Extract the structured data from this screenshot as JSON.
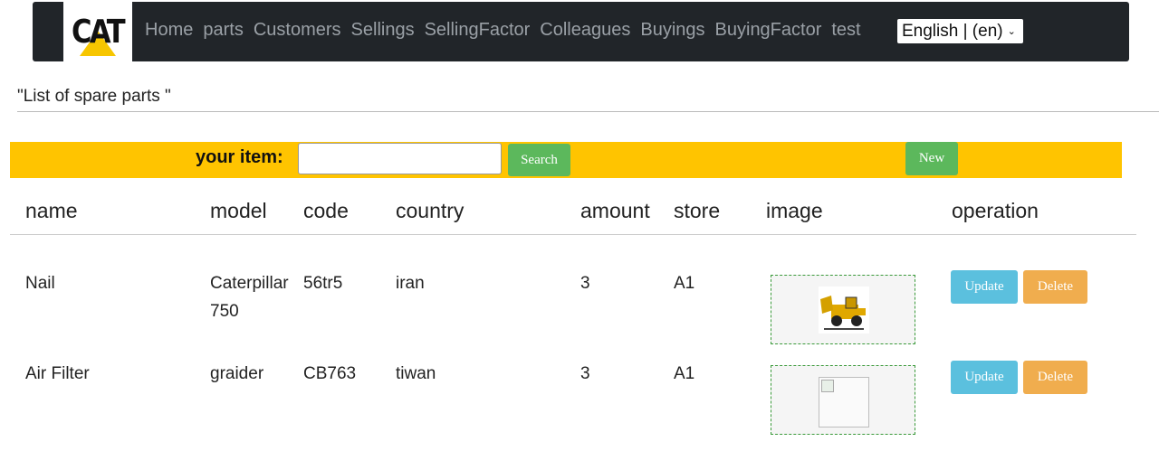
{
  "navbar": {
    "logo_text": "CAT",
    "links": [
      "Home",
      "parts",
      "Customers",
      "Sellings",
      "SellingFactor",
      "Colleagues",
      "Buyings",
      "BuyingFactor",
      "test"
    ],
    "language": "English | (en)"
  },
  "page_title": "\"List of spare parts \"",
  "search": {
    "label": "your item:",
    "value": "",
    "button": "Search",
    "new_button": "New"
  },
  "table": {
    "headers": [
      "name",
      "model",
      "code",
      "country",
      "amount",
      "store",
      "image",
      "operation"
    ],
    "rows": [
      {
        "name": "Nail",
        "model_line1": "Caterpillar",
        "model_line2": "750",
        "code": "56tr5",
        "country": "iran",
        "amount": "3",
        "store": "A1",
        "image": "loader-thumbnail"
      },
      {
        "name": "Air Filter",
        "model_line1": "graider",
        "model_line2": "",
        "code": "CB763",
        "country": "tiwan",
        "amount": "3",
        "store": "A1",
        "image": "broken-image"
      }
    ],
    "update_label": "Update",
    "delete_label": "Delete"
  },
  "colors": {
    "navbar": "#212529",
    "accent_yellow": "#ffc400",
    "green": "#5cb85c",
    "info": "#5bc0de",
    "warning": "#f0ad4e"
  }
}
